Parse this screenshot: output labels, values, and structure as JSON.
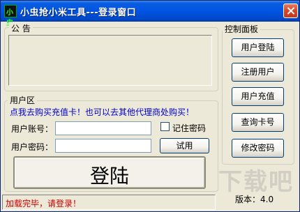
{
  "window": {
    "title": "小虫抢小米工具---登录窗口",
    "icon_label": "小虫",
    "close_icon": "close-icon"
  },
  "notice": {
    "label": "公 告",
    "content": ""
  },
  "user_area": {
    "label": "用户区",
    "promo_link": "点我去购买充值卡！也可以去其他代理商处购买！",
    "account_label": "用户账号：",
    "account_value": "",
    "password_label": "用户密码：",
    "password_value": "",
    "remember_label": "记住密码",
    "remember_checked": false,
    "trial_button": "试用",
    "login_button": "登陆"
  },
  "control_panel": {
    "label": "控制面板",
    "buttons": [
      "用户登陆",
      "注册用户",
      "用户充值",
      "查询卡号",
      "修改密码"
    ]
  },
  "status": {
    "text": "加载完毕，请登录！",
    "color": "#cc0000"
  },
  "version": "版本：4.0",
  "watermark": "下载吧"
}
